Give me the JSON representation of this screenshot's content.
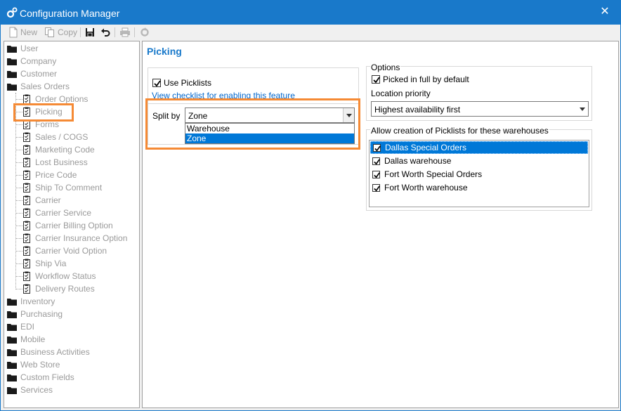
{
  "window": {
    "title": "Configuration Manager",
    "close": "✕"
  },
  "toolbar": {
    "new_label": "New",
    "copy_label": "Copy"
  },
  "tree": {
    "root_top": [
      {
        "label": "User"
      },
      {
        "label": "Company"
      },
      {
        "label": "Customer"
      },
      {
        "label": "Sales Orders"
      }
    ],
    "sales_children": [
      {
        "label": "Order Options"
      },
      {
        "label": "Picking"
      },
      {
        "label": "Forms"
      },
      {
        "label": "Sales / COGS"
      },
      {
        "label": "Marketing Code"
      },
      {
        "label": "Lost Business"
      },
      {
        "label": "Price Code"
      },
      {
        "label": "Ship To Comment"
      },
      {
        "label": "Carrier"
      },
      {
        "label": "Carrier Service"
      },
      {
        "label": "Carrier Billing Option"
      },
      {
        "label": "Carrier Insurance Option"
      },
      {
        "label": "Carrier Void Option"
      },
      {
        "label": "Ship Via"
      },
      {
        "label": "Workflow Status"
      },
      {
        "label": "Delivery Routes"
      }
    ],
    "root_bottom": [
      {
        "label": "Inventory"
      },
      {
        "label": "Purchasing"
      },
      {
        "label": "EDI"
      },
      {
        "label": "Mobile"
      },
      {
        "label": "Business Activities"
      },
      {
        "label": "Web Store"
      },
      {
        "label": "Custom Fields"
      },
      {
        "label": "Services"
      }
    ]
  },
  "picking": {
    "title": "Picking",
    "use_picklists": {
      "label": "Use Picklists",
      "checked": true
    },
    "checklist_link": "View checklist for enabling this feature",
    "split_by": {
      "label": "Split by",
      "value": "Zone",
      "options": [
        "Warehouse",
        "Zone"
      ],
      "selected_index": 1
    },
    "options": {
      "title": "Options",
      "picked_in_full": {
        "label": "Picked in full by default",
        "checked": true
      },
      "location_priority_label": "Location priority",
      "location_priority_value": "Highest availability first"
    },
    "warehouses": {
      "title": "Allow creation of Picklists for these warehouses",
      "items": [
        {
          "label": "Dallas Special Orders",
          "checked": true,
          "selected": true
        },
        {
          "label": "Dallas warehouse",
          "checked": true,
          "selected": false
        },
        {
          "label": "Fort Worth Special Orders",
          "checked": true,
          "selected": false
        },
        {
          "label": "Fort Worth warehouse",
          "checked": true,
          "selected": false
        }
      ]
    }
  },
  "colors": {
    "accent": "#1979ca",
    "highlight": "#f58a35",
    "selection": "#0078d7",
    "link": "#0066cc"
  }
}
